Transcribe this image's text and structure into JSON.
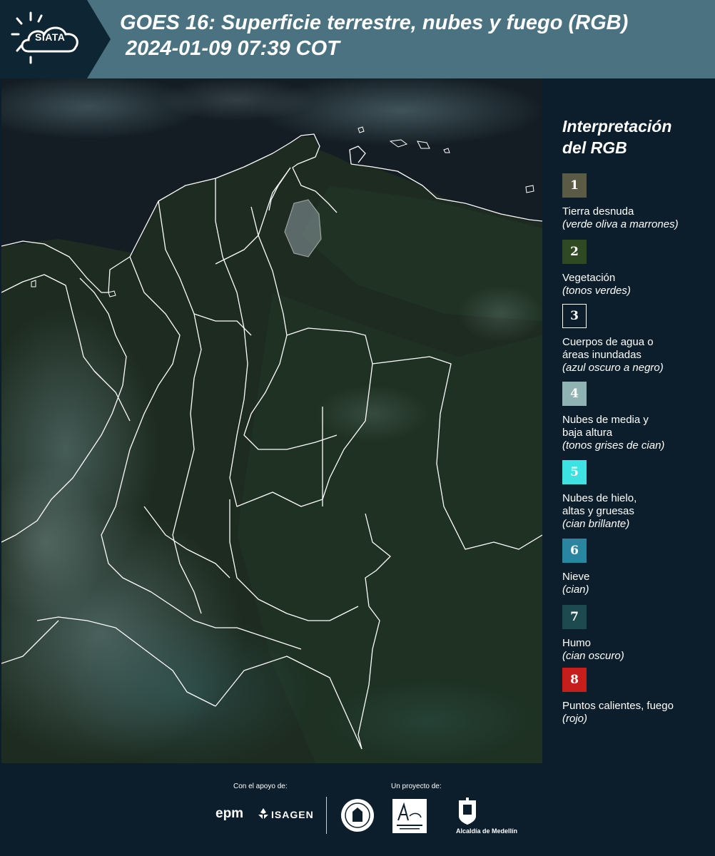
{
  "header": {
    "logo_text": "SIATA",
    "title_line1": "GOES 16: Superficie terrestre, nubes y fuego (RGB)",
    "title_line2": "2024-01-09 07:39 COT"
  },
  "legend": {
    "title_line1": "Interpretación",
    "title_line2": "del RGB",
    "items": [
      {
        "number": "1",
        "color": "#5b5b45",
        "lines": [
          "Tierra desnuda"
        ],
        "desc": "(verde oliva a marrones)"
      },
      {
        "number": "2",
        "color": "#2f4a22",
        "lines": [
          "Vegetación"
        ],
        "desc": "(tonos verdes)"
      },
      {
        "number": "3",
        "color": "#0c1e2b",
        "lines": [
          "Cuerpos de agua o",
          "áreas inundadas"
        ],
        "desc": "(azul oscuro a negro)"
      },
      {
        "number": "4",
        "color": "#8fb3b2",
        "lines": [
          "Nubes de media y",
          "baja altura"
        ],
        "desc": "(tonos grises de cian)"
      },
      {
        "number": "5",
        "color": "#3de3e3",
        "lines": [
          "Nubes de hielo,",
          "altas y gruesas"
        ],
        "desc": "(cian brillante)"
      },
      {
        "number": "6",
        "color": "#2a86a0",
        "lines": [
          "Nieve"
        ],
        "desc": "(cian)"
      },
      {
        "number": "7",
        "color": "#1d4a4e",
        "lines": [
          "Humo"
        ],
        "desc": "(cian oscuro)"
      },
      {
        "number": "8",
        "color": "#c61d1d",
        "lines": [
          "Puntos calientes, fuego"
        ],
        "desc": "(rojo)"
      }
    ]
  },
  "footer": {
    "support_label": "Con el apoyo de:",
    "project_label": "Un proyecto de:",
    "sponsor_epm": "epm",
    "sponsor_isagen": "ISAGEN",
    "alcaldia_text": "Alcaldía de Medellín"
  }
}
